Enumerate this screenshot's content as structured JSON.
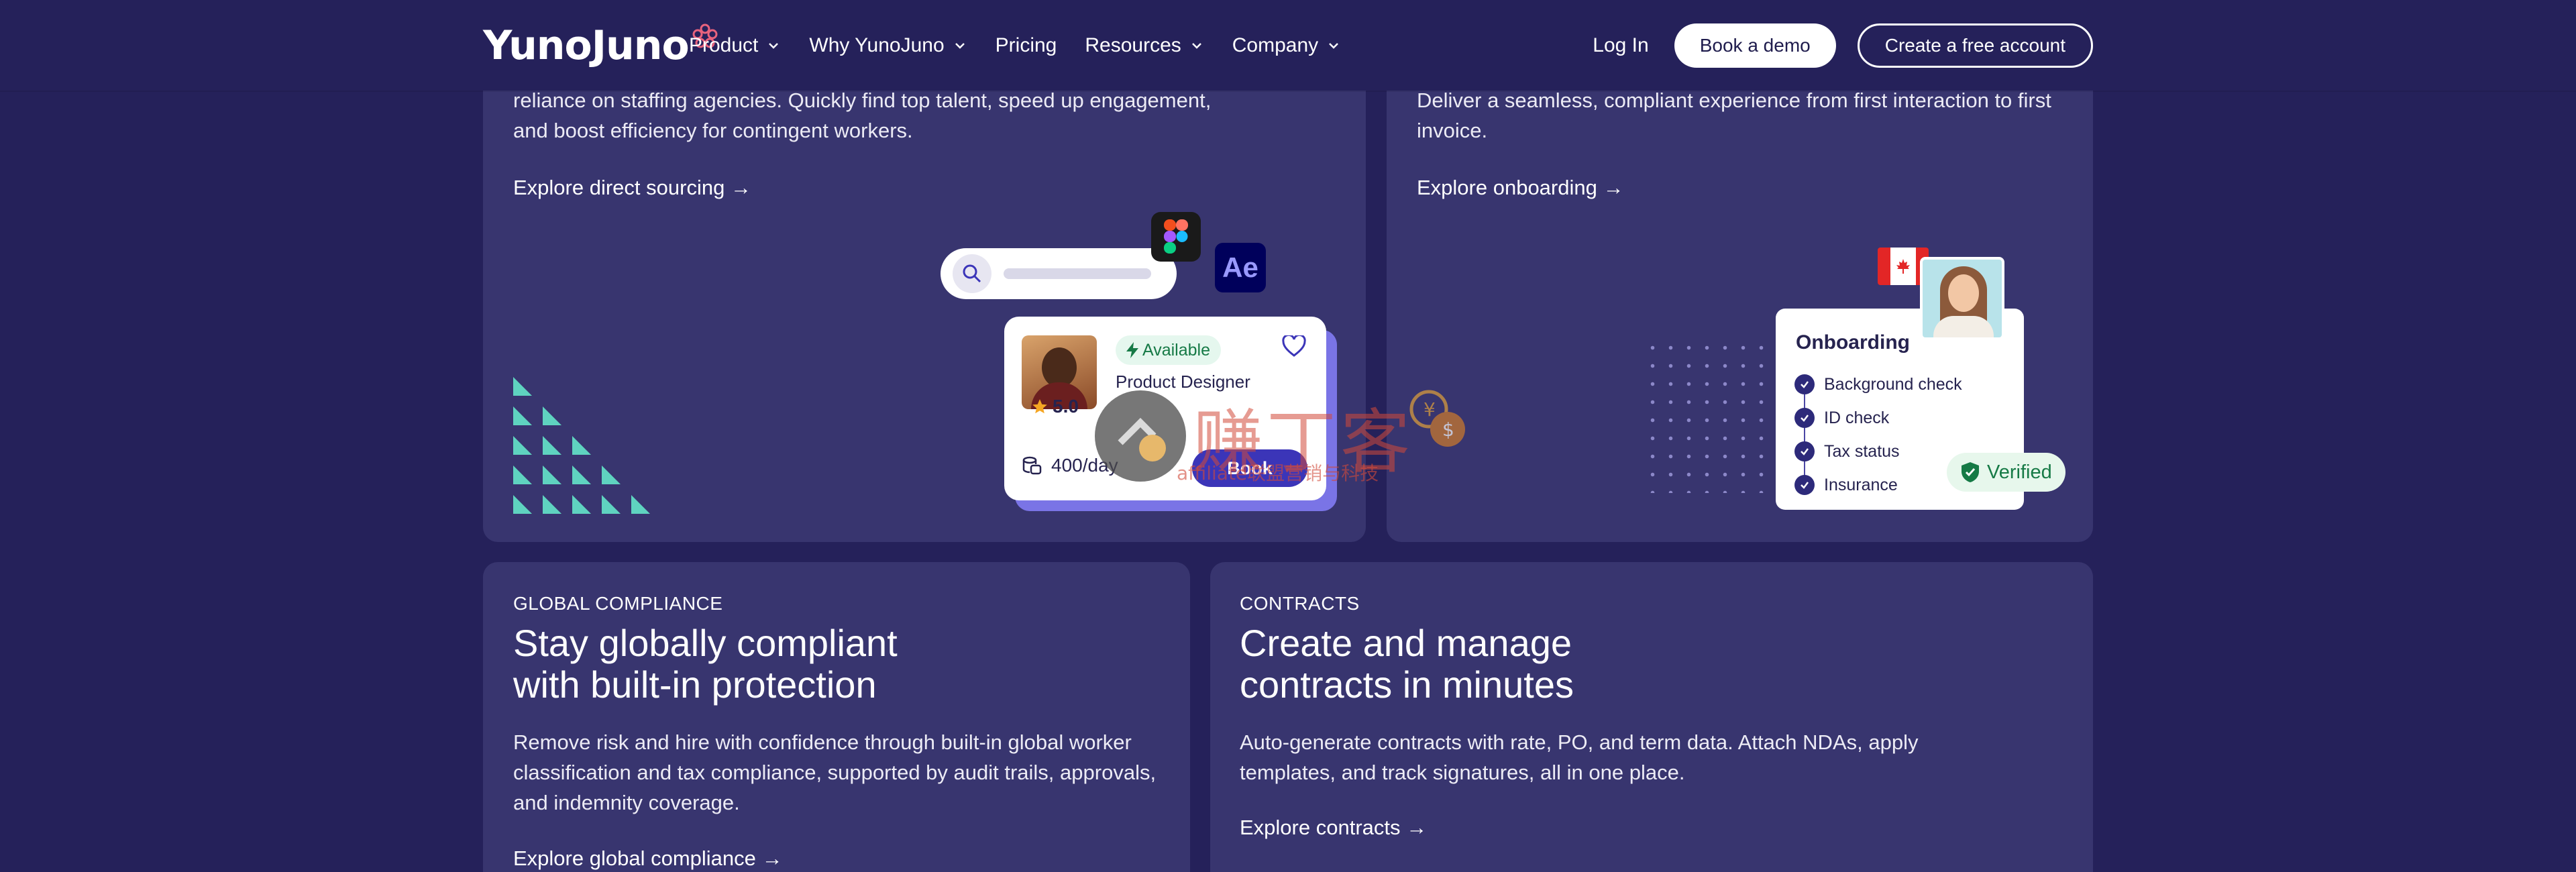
{
  "header": {
    "logo_text": "YunoJuno",
    "nav": [
      {
        "label": "Product",
        "has_dropdown": true
      },
      {
        "label": "Why YunoJuno",
        "has_dropdown": true
      },
      {
        "label": "Pricing",
        "has_dropdown": false
      },
      {
        "label": "Resources",
        "has_dropdown": true
      },
      {
        "label": "Company",
        "has_dropdown": true
      }
    ],
    "login": "Log In",
    "book_demo": "Book a demo",
    "create_account": "Create a free account"
  },
  "sourcing": {
    "desc_line1": "reliance on staffing agencies. Quickly find top talent, speed up engagement,",
    "desc_line2": "and boost efficiency for contingent workers.",
    "link": "Explore direct sourcing →",
    "ae_label": "Ae",
    "profile": {
      "rating": "5.0",
      "status": "Available",
      "role": "Product Designer",
      "rate": "400/day",
      "book_label": "Book"
    }
  },
  "onboarding": {
    "desc_line1": "Deliver a seamless, compliant experience from first interaction to first",
    "desc_line2": "invoice.",
    "link": "Explore onboarding →",
    "card_title": "Onboarding",
    "checks": [
      "Background check",
      "ID check",
      "Tax status",
      "Insurance"
    ],
    "verified_label": "Verified"
  },
  "compliance": {
    "eyebrow": "GLOBAL COMPLIANCE",
    "title_line1": "Stay globally compliant",
    "title_line2": "with built-in protection",
    "desc_line1": "Remove risk and hire with confidence through built-in global worker",
    "desc_line2": "classification and tax compliance, supported by audit trails, approvals,",
    "desc_line3": "and indemnity coverage.",
    "link": "Explore global compliance →"
  },
  "contracts": {
    "eyebrow": "CONTRACTS",
    "title_line1": "Create and manage",
    "title_line2": "contracts in minutes",
    "desc_line1": "Auto-generate contracts with rate, PO, and term data. Attach NDAs, apply",
    "desc_line2": "templates, and track signatures, all in one place.",
    "link": "Explore contracts →"
  },
  "watermark": {
    "chinese": "赚丁客",
    "latin": "affiliate联盟营销与科技"
  },
  "colors": {
    "page_bg": "#25215a",
    "card_bg": "#38356f",
    "accent_teal": "#5fd3c0",
    "accent_purple": "#3b35b8",
    "success_green": "#167a46"
  }
}
